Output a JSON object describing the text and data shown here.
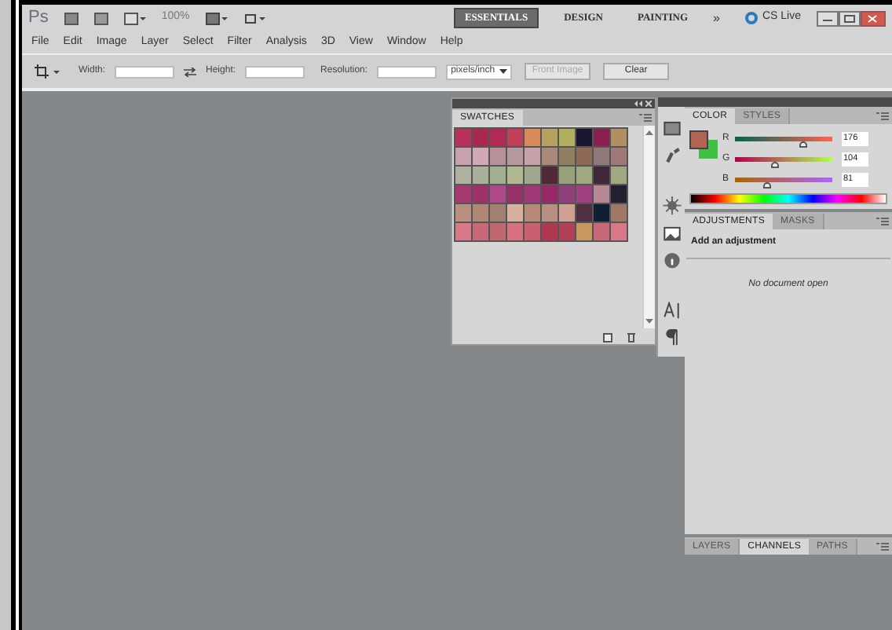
{
  "app_bar": {
    "logo": "Ps",
    "zoom": "100%",
    "workspaces": [
      {
        "label": "ESSENTIALS",
        "selected": true
      },
      {
        "label": "DESIGN",
        "selected": false
      },
      {
        "label": "PAINTING",
        "selected": false
      }
    ],
    "more": "»",
    "cs_live": "CS Live"
  },
  "menu": [
    "File",
    "Edit",
    "Image",
    "Layer",
    "Select",
    "Filter",
    "Analysis",
    "3D",
    "View",
    "Window",
    "Help"
  ],
  "options_bar": {
    "width_label": "Width:",
    "height_label": "Height:",
    "resolution_label": "Resolution:",
    "unit": "pixels/inch",
    "buttons": [
      {
        "label": "Front Image",
        "disabled": true
      },
      {
        "label": "Clear",
        "disabled": false
      }
    ]
  },
  "swatches_panel": {
    "tabs": [
      {
        "label": "SWATCHES",
        "selected": true
      }
    ],
    "swatches": [
      {
        "color": "#b8335a"
      },
      {
        "color": "#a8294f"
      },
      {
        "color": "#b02a55"
      },
      {
        "color": "#c0405a"
      },
      {
        "color": "#d88a5a"
      },
      {
        "color": "#b8a060"
      },
      {
        "color": "#b0b060"
      },
      {
        "color": "#1a1830"
      },
      {
        "color": "#8a2050"
      },
      {
        "color": "#b09060"
      },
      {
        "color": "#c8a0b0"
      },
      {
        "color": "#d0a8b8"
      },
      {
        "color": "#b89098"
      },
      {
        "color": "#b898a0"
      },
      {
        "color": "#c8a0a8"
      },
      {
        "color": "#a88878"
      },
      {
        "color": "#908060"
      },
      {
        "color": "#906858"
      },
      {
        "color": "#907878"
      },
      {
        "color": "#a07878"
      },
      {
        "color": "#b0b0a0"
      },
      {
        "color": "#a8b098"
      },
      {
        "color": "#a0b090"
      },
      {
        "color": "#b0b890"
      },
      {
        "color": "#a0a890"
      },
      {
        "color": "#502838"
      },
      {
        "color": "#98a078"
      },
      {
        "color": "#a0a880"
      },
      {
        "color": "#402838"
      },
      {
        "color": "#a0a881"
      },
      {
        "color": "#a83870"
      },
      {
        "color": "#a03068"
      },
      {
        "color": "#b04888"
      },
      {
        "color": "#983068"
      },
      {
        "color": "#a03878"
      },
      {
        "color": "#982868"
      },
      {
        "color": "#904078"
      },
      {
        "color": "#a04080"
      },
      {
        "color": "#b88898"
      },
      {
        "color": "#202030"
      },
      {
        "color": "#b89080"
      },
      {
        "color": "#b08878"
      },
      {
        "color": "#a08070"
      },
      {
        "color": "#d8b0a0"
      },
      {
        "color": "#b88878"
      },
      {
        "color": "#b89081"
      },
      {
        "color": "#d0a090"
      },
      {
        "color": "#503040"
      },
      {
        "color": "#102030"
      },
      {
        "color": "#a07868"
      },
      {
        "color": "#d87888"
      },
      {
        "color": "#c86878"
      },
      {
        "color": "#c06870"
      },
      {
        "color": "#d87080"
      },
      {
        "color": "#c86070"
      },
      {
        "color": "#b03850"
      },
      {
        "color": "#b04058"
      },
      {
        "color": "#c89860"
      },
      {
        "color": "#c86879"
      },
      {
        "color": "#d87889"
      }
    ]
  },
  "color_panel": {
    "tabs": [
      {
        "label": "COLOR",
        "selected": true
      },
      {
        "label": "STYLES",
        "selected": false
      }
    ],
    "color_swatches": [
      {
        "kind": "foreground",
        "color": "#b06451"
      },
      {
        "kind": "background",
        "color": "#40c040"
      }
    ],
    "channels": [
      {
        "name": "R",
        "level": 0.69,
        "reading": "176"
      },
      {
        "name": "G",
        "level": 0.41,
        "reading": "104"
      },
      {
        "name": "B",
        "level": 0.32,
        "reading": "81"
      }
    ]
  },
  "adjustments_panel": {
    "tabs": [
      {
        "label": "ADJUSTMENTS",
        "selected": true
      },
      {
        "label": "MASKS",
        "selected": false
      }
    ],
    "heading": "Add an adjustment",
    "message": "No document open"
  },
  "layers_panel": {
    "tabs": [
      {
        "label": "LAYERS",
        "selected": false
      },
      {
        "label": "CHANNELS",
        "selected": true
      },
      {
        "label": "PATHS",
        "selected": false
      }
    ]
  }
}
